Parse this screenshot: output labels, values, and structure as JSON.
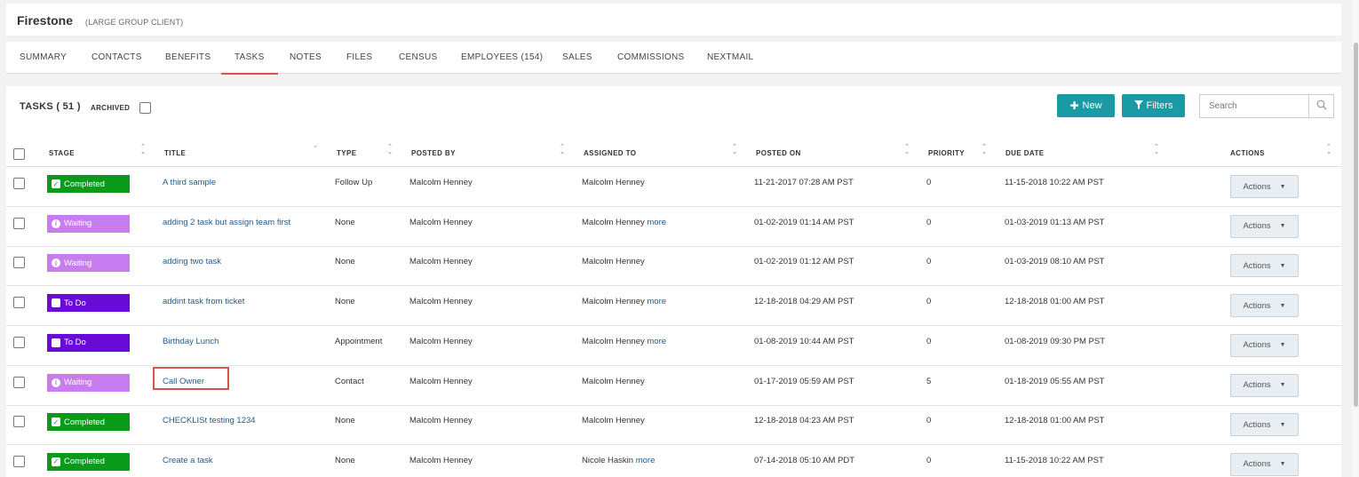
{
  "client": {
    "name": "Firestone",
    "type": "(LARGE GROUP CLIENT)"
  },
  "tabs": [
    "SUMMARY",
    "CONTACTS",
    "BENEFITS",
    "TASKS",
    "NOTES",
    "FILES",
    "CENSUS",
    "EMPLOYEES (154)",
    "SALES",
    "COMMISSIONS",
    "NEXTMAIL"
  ],
  "active_tab": "TASKS",
  "toolbar": {
    "title": "TASKS ( 51 )",
    "archived_label": "ARCHIVED",
    "new_label": "New",
    "filters_label": "Filters",
    "search_placeholder": "Search"
  },
  "columns": {
    "stage": "STAGE",
    "title": "TITLE",
    "type": "TYPE",
    "posted_by": "POSTED BY",
    "assigned_to": "ASSIGNED TO",
    "posted_on": "POSTED ON",
    "priority": "PRIORITY",
    "due_date": "DUE DATE",
    "actions": "ACTIONS"
  },
  "stage_colors": {
    "Completed": "#0a9a1a",
    "Waiting": "#c77cf0",
    "To Do": "#6a0ad6"
  },
  "rows": [
    {
      "stage": "Completed",
      "title": "A third sample",
      "type": "Follow Up",
      "posted_by": "Malcolm Henney",
      "assigned_to": "Malcolm Henney",
      "more": "",
      "posted_on": "11-21-2017 07:28 AM PST",
      "priority": "0",
      "due_date": "11-15-2018 10:22 AM PST",
      "action_label": "Actions"
    },
    {
      "stage": "Waiting",
      "title": "adding 2 task but assign team first",
      "type": "None",
      "posted_by": "Malcolm Henney",
      "assigned_to": "Malcolm Henney",
      "more": "more",
      "posted_on": "01-02-2019 01:14 AM PST",
      "priority": "0",
      "due_date": "01-03-2019 01:13 AM PST",
      "action_label": "Actions"
    },
    {
      "stage": "Waiting",
      "title": "adding two task",
      "type": "None",
      "posted_by": "Malcolm Henney",
      "assigned_to": "Malcolm Henney",
      "more": "",
      "posted_on": "01-02-2019 01:12 AM PST",
      "priority": "0",
      "due_date": "01-03-2019 08:10 AM PST",
      "action_label": "Actions"
    },
    {
      "stage": "To Do",
      "title": "addint task from ticket",
      "type": "None",
      "posted_by": "Malcolm Henney",
      "assigned_to": "Malcolm Henney",
      "more": "more",
      "posted_on": "12-18-2018 04:29 AM PST",
      "priority": "0",
      "due_date": "12-18-2018 01:00 AM PST",
      "action_label": "Actions"
    },
    {
      "stage": "To Do",
      "title": "Birthday Lunch",
      "type": "Appointment",
      "posted_by": "Malcolm Henney",
      "assigned_to": "Malcolm Henney",
      "more": "more",
      "posted_on": "01-08-2019 10:44 AM PST",
      "priority": "0",
      "due_date": "01-08-2019 09:30 PM PST",
      "action_label": "Actions"
    },
    {
      "stage": "Waiting",
      "title": "Call Owner",
      "type": "Contact",
      "posted_by": "Malcolm Henney",
      "assigned_to": "Malcolm Henney",
      "more": "",
      "posted_on": "01-17-2019 05:59 AM PST",
      "priority": "5",
      "due_date": "01-18-2019 05:55 AM PST",
      "action_label": "Actions"
    },
    {
      "stage": "Completed",
      "title": "CHECKLISt testing 1234",
      "type": "None",
      "posted_by": "Malcolm Henney",
      "assigned_to": "Malcolm Henney",
      "more": "",
      "posted_on": "12-18-2018 04:23 AM PST",
      "priority": "0",
      "due_date": "12-18-2018 01:00 AM PST",
      "action_label": "Actions"
    },
    {
      "stage": "Completed",
      "title": "Create a task",
      "type": "None",
      "posted_by": "Malcolm Henney",
      "assigned_to": "Nicole Haskin",
      "more": "more",
      "posted_on": "07-14-2018 05:10 AM PDT",
      "priority": "0",
      "due_date": "11-15-2018 10:22 AM PST",
      "action_label": "Actions"
    }
  ]
}
